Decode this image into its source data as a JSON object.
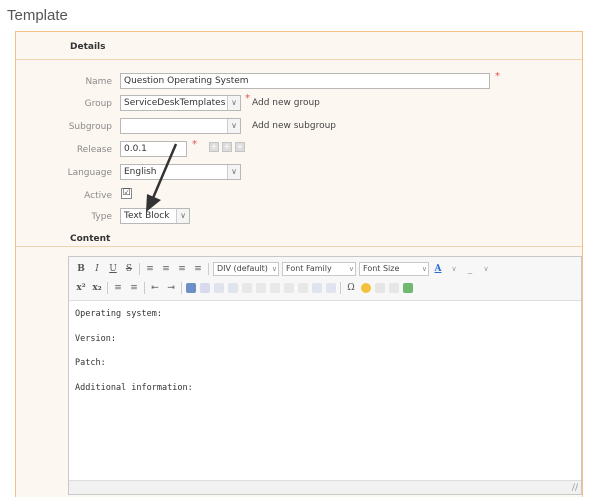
{
  "page_title": "Template",
  "details": {
    "header": "Details",
    "name": {
      "label": "Name",
      "value": "Question Operating System",
      "required": "*"
    },
    "group": {
      "label": "Group",
      "value": "ServiceDeskTemplates",
      "required": "*",
      "add_link": "Add new group"
    },
    "subgroup": {
      "label": "Subgroup",
      "value": "",
      "add_link": "Add new subgroup"
    },
    "release": {
      "label": "Release",
      "value": "0.0.1",
      "required": "*"
    },
    "language": {
      "label": "Language",
      "value": "English"
    },
    "active": {
      "label": "Active",
      "checked": "☑"
    },
    "type": {
      "label": "Type",
      "value": "Text Block"
    }
  },
  "content": {
    "header": "Content",
    "required": "*",
    "toolbar": {
      "bold": "B",
      "italic": "I",
      "underline": "U",
      "strike": "S",
      "format_combo": "DIV (default)",
      "font_family_combo": "Font Family",
      "font_size_combo": "Font Size",
      "font_color": "A",
      "superscript": "x²",
      "subscript": "x₂",
      "omega": "Ω"
    },
    "body_lines": [
      "Operating system:",
      "Version:",
      "Patch:",
      "Additional information:"
    ]
  },
  "icons": {
    "dropdown": "∨",
    "plus": "+",
    "resize": "//"
  },
  "colors": {
    "panel_border": "#f3c089",
    "panel_bg": "#fdf7f1",
    "required": "#e05050"
  }
}
